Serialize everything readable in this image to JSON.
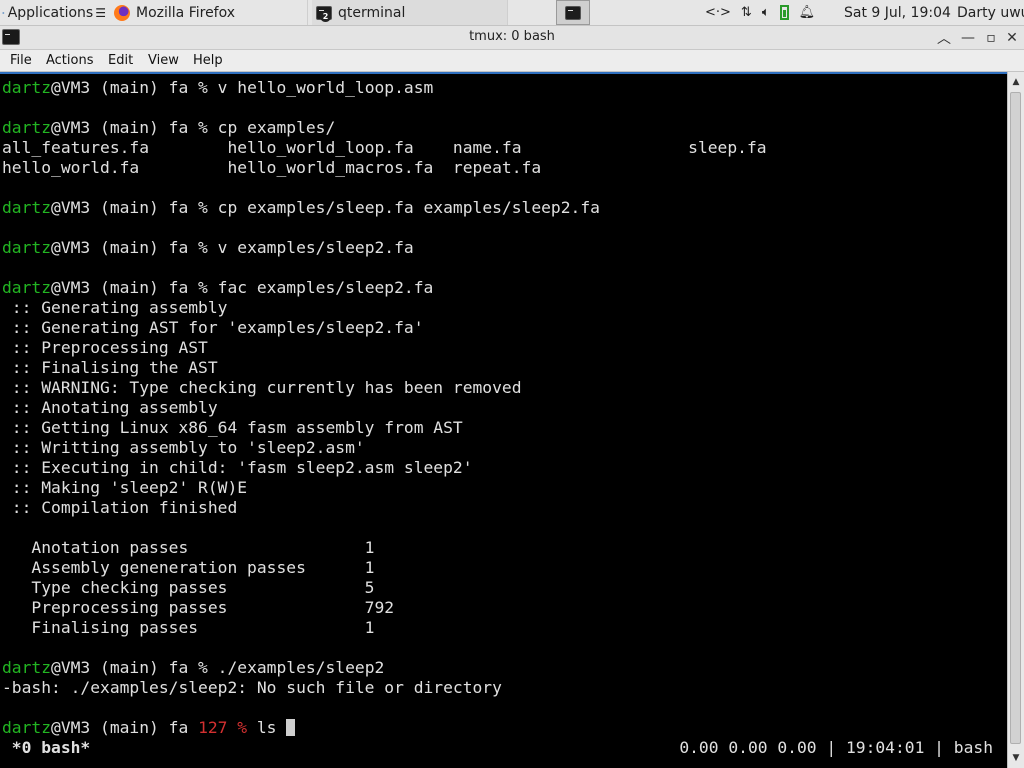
{
  "panel": {
    "apps_label": "Applications",
    "apps_icon": "xfce-mouse-icon",
    "tasks": [
      {
        "label": "Mozilla Firefox",
        "icon": "firefox-icon"
      },
      {
        "label": "qterminal",
        "icon": "terminal-icon",
        "group_count": "2"
      }
    ],
    "launcher_icon": "terminal-icon",
    "tray": {
      "network_icon": "network-icon",
      "transfer_icon": "transfer-arrows-icon",
      "volume_icon": "volume-icon",
      "battery_icon": "battery-icon",
      "notification_icon": "bell-icon"
    },
    "clock": "Sat  9 Jul, 19:04",
    "user": "Darty uwu"
  },
  "window": {
    "title": "tmux: 0 bash",
    "buttons": [
      "chevron-up-icon",
      "minimize-icon",
      "maximize-icon",
      "close-icon"
    ]
  },
  "menubar": {
    "file": "File",
    "actions": "Actions",
    "edit": "Edit",
    "view": "View",
    "help": "Help"
  },
  "colors": {
    "prompt_user": "#22b522",
    "error_code": "#d33030",
    "terminal_bg": "#000000",
    "terminal_fg": "#e0e0e0"
  },
  "terminal": {
    "prompt_user": "dartz",
    "prompt_rest": "@VM3 (main) fa % ",
    "cmd1": "v hello_world_loop.asm",
    "cmd2": "cp examples/",
    "ls_row1": "all_features.fa        hello_world_loop.fa    name.fa                 sleep.fa",
    "ls_row2": "hello_world.fa         hello_world_macros.fa  repeat.fa",
    "cmd3": "cp examples/sleep.fa examples/sleep2.fa",
    "cmd4": "v examples/sleep2.fa",
    "cmd5": "fac examples/sleep2.fa",
    "compile_log": [
      " :: Generating assembly",
      " :: Generating AST for 'examples/sleep2.fa'",
      " :: Preprocessing AST",
      " :: Finalising the AST",
      " :: WARNING: Type checking currently has been removed",
      " :: Anotating assembly",
      " :: Getting Linux x86_64 fasm assembly from AST",
      " :: Writting assembly to 'sleep2.asm'",
      " :: Executing in child: 'fasm sleep2.asm sleep2'",
      " :: Making 'sleep2' R(W)E",
      " :: Compilation finished"
    ],
    "stats": [
      "   Anotation passes                  1",
      "   Assembly geneneration passes      1",
      "   Type checking passes              5",
      "   Preprocessing passes              792",
      "   Finalising passes                 1"
    ],
    "cmd6": "./examples/sleep2",
    "error_line": "-bash: ./examples/sleep2: No such file or directory",
    "last_prompt_mid": "@VM3 (main) fa ",
    "last_code": "127 %",
    "last_cmd": " ls "
  },
  "tmux_status": {
    "left": " *0 bash*",
    "right": "0.00 0.00 0.00 | 19:04:01 | bash"
  }
}
